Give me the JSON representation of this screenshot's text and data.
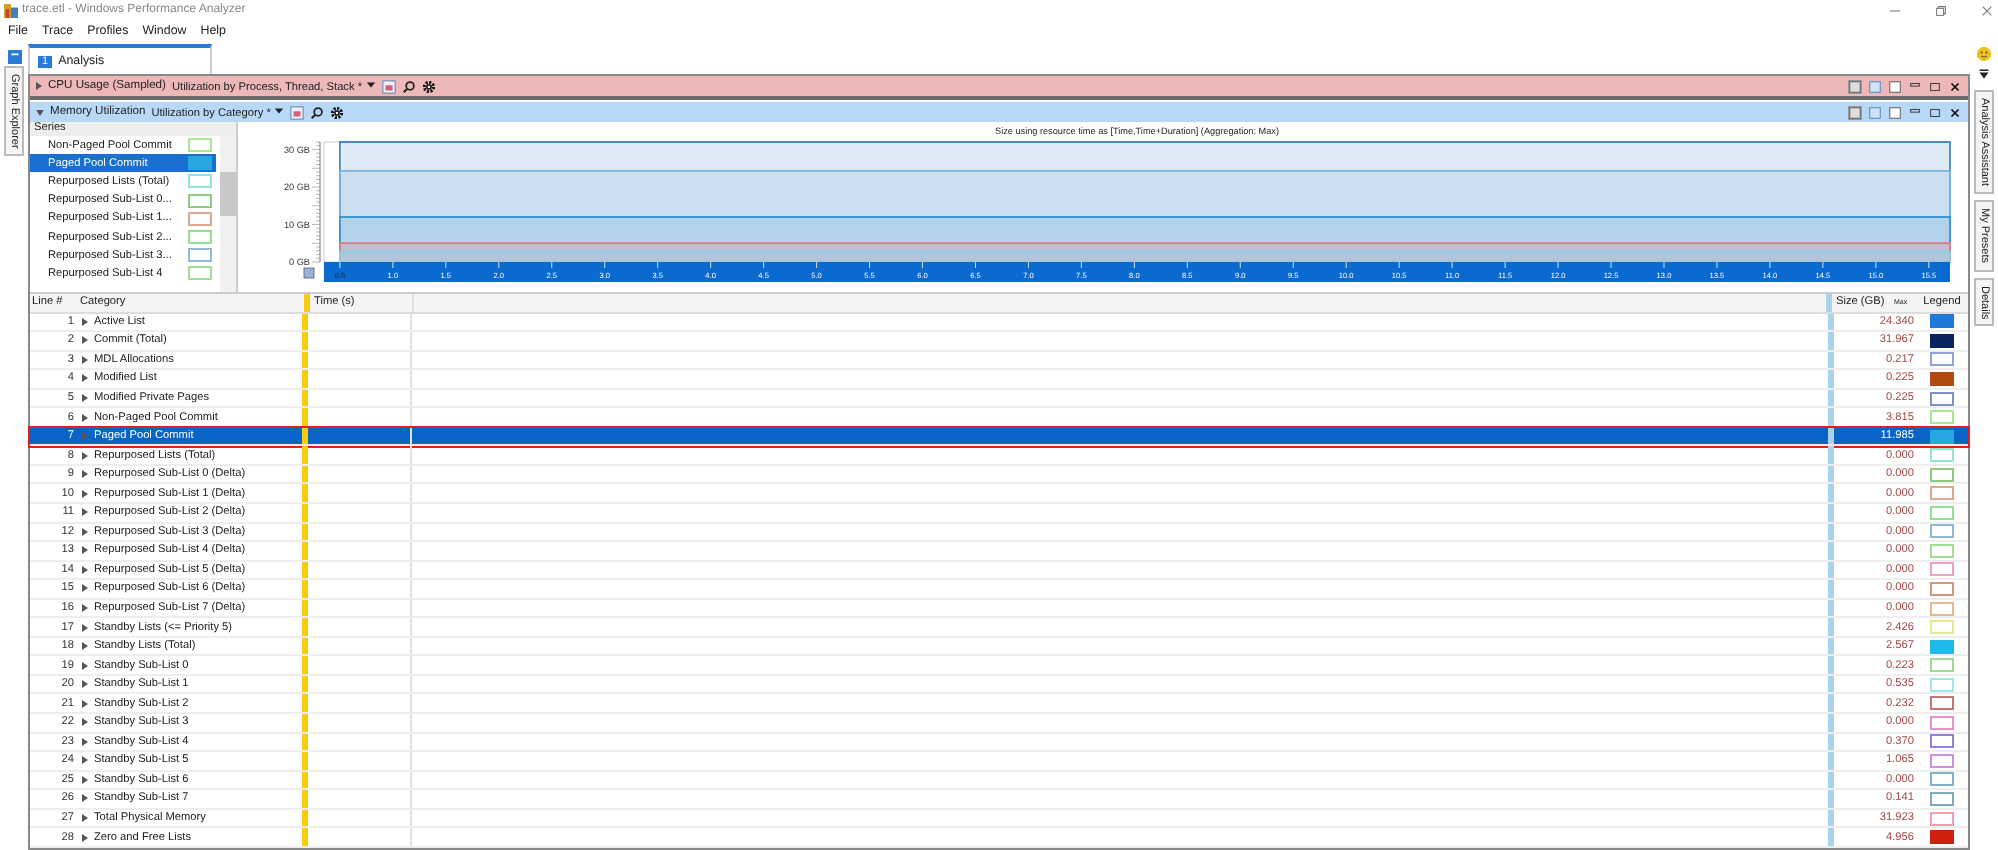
{
  "window": {
    "title": "trace.etl - Windows Performance Analyzer"
  },
  "menu": [
    "File",
    "Trace",
    "Profiles",
    "Window",
    "Help"
  ],
  "left_tabs": [
    {
      "label": "Graph Explorer"
    }
  ],
  "right_tabs": [
    {
      "label": "Analysis Assistant"
    },
    {
      "label": "My Presets"
    },
    {
      "label": "Details"
    }
  ],
  "analysis_tab": {
    "number": "1",
    "label": "Analysis"
  },
  "graphs": [
    {
      "title": "CPU Usage (Sampled)",
      "preset": "Utilization by Process, Thread, Stack *",
      "expanded": false
    },
    {
      "title": "Memory Utilization",
      "preset": "Utilization by Category *",
      "expanded": true
    }
  ],
  "series_panel": {
    "heading": "Series",
    "items": [
      {
        "label": "Non-Paged Pool Commit",
        "color": "#a8e890",
        "filled": false,
        "selected": false
      },
      {
        "label": "Paged Pool Commit",
        "color": "#28a8e0",
        "filled": true,
        "selected": true
      },
      {
        "label": "Repurposed Lists (Total)",
        "color": "#90e8d0",
        "filled": false,
        "selected": false
      },
      {
        "label": "Repurposed Sub-List 0...",
        "color": "#90c880",
        "filled": false,
        "selected": false
      },
      {
        "label": "Repurposed Sub-List 1...",
        "color": "#e0a890",
        "filled": false,
        "selected": false
      },
      {
        "label": "Repurposed Sub-List 2...",
        "color": "#90e090",
        "filled": false,
        "selected": false
      },
      {
        "label": "Repurposed Sub-List 3...",
        "color": "#90b8d8",
        "filled": false,
        "selected": false
      },
      {
        "label": "Repurposed Sub-List 4",
        "color": "#a0e090",
        "filled": false,
        "selected": false
      }
    ]
  },
  "chart": {
    "title": "Size using resource time as [Time,Time+Duration] (Aggregation: Max)",
    "y_labels": [
      "30 GB",
      "20 GB",
      "10 GB",
      "0 GB"
    ],
    "x_labels": [
      "0.5",
      "1.0",
      "1.5",
      "2.0",
      "2.5",
      "3.0",
      "3.5",
      "4.0",
      "4.5",
      "5.0",
      "5.5",
      "6.0",
      "6.5",
      "7.0",
      "7.5",
      "8.0",
      "8.5",
      "9.0",
      "9.5",
      "10.0",
      "10.5",
      "11.0",
      "11.5",
      "12.0",
      "12.5",
      "13.0",
      "13.5",
      "14.0",
      "14.5",
      "15.0",
      "15.5"
    ]
  },
  "table": {
    "columns": [
      "Line #",
      "Category",
      "Time (s)",
      "Size (GB)",
      "Legend"
    ],
    "size_aggregation": "Max",
    "rows": [
      {
        "line": "1",
        "category": "Active List",
        "size": "24.340",
        "color": "#1e78d8",
        "filled": true,
        "selected": false
      },
      {
        "line": "2",
        "category": "Commit (Total)",
        "size": "31.967",
        "color": "#0a2460",
        "filled": true,
        "selected": false
      },
      {
        "line": "3",
        "category": "MDL Allocations",
        "size": "0.217",
        "color": "#8fa4d8",
        "filled": false,
        "selected": false
      },
      {
        "line": "4",
        "category": "Modified List",
        "size": "0.225",
        "color": "#b04a10",
        "filled": true,
        "selected": false
      },
      {
        "line": "5",
        "category": "Modified Private Pages",
        "size": "0.225",
        "color": "#8090c0",
        "filled": false,
        "selected": false
      },
      {
        "line": "6",
        "category": "Non-Paged Pool Commit",
        "size": "3.815",
        "color": "#a8e890",
        "filled": false,
        "selected": false
      },
      {
        "line": "7",
        "category": "Paged Pool Commit",
        "size": "11.985",
        "color": "#28a8e0",
        "filled": true,
        "selected": true
      },
      {
        "line": "8",
        "category": "Repurposed Lists (Total)",
        "size": "0.000",
        "color": "#90e8d0",
        "filled": false,
        "selected": false
      },
      {
        "line": "9",
        "category": "Repurposed Sub-List 0 (Delta)",
        "size": "0.000",
        "color": "#90c880",
        "filled": false,
        "selected": false
      },
      {
        "line": "10",
        "category": "Repurposed Sub-List 1 (Delta)",
        "size": "0.000",
        "color": "#e0a890",
        "filled": false,
        "selected": false
      },
      {
        "line": "11",
        "category": "Repurposed Sub-List 2 (Delta)",
        "size": "0.000",
        "color": "#90e090",
        "filled": false,
        "selected": false
      },
      {
        "line": "12",
        "category": "Repurposed Sub-List 3 (Delta)",
        "size": "0.000",
        "color": "#90b8d8",
        "filled": false,
        "selected": false
      },
      {
        "line": "13",
        "category": "Repurposed Sub-List 4 (Delta)",
        "size": "0.000",
        "color": "#a0e090",
        "filled": false,
        "selected": false
      },
      {
        "line": "14",
        "category": "Repurposed Sub-List 5 (Delta)",
        "size": "0.000",
        "color": "#f0a0c0",
        "filled": false,
        "selected": false
      },
      {
        "line": "15",
        "category": "Repurposed Sub-List 6 (Delta)",
        "size": "0.000",
        "color": "#d09880",
        "filled": false,
        "selected": false
      },
      {
        "line": "16",
        "category": "Repurposed Sub-List 7 (Delta)",
        "size": "0.000",
        "color": "#e8b890",
        "filled": false,
        "selected": false
      },
      {
        "line": "17",
        "category": "Standby Lists (<= Priority 5)",
        "size": "2.426",
        "color": "#e8e890",
        "filled": false,
        "selected": false
      },
      {
        "line": "18",
        "category": "Standby Lists (Total)",
        "size": "2.567",
        "color": "#20b8e8",
        "filled": true,
        "selected": false
      },
      {
        "line": "19",
        "category": "Standby Sub-List 0",
        "size": "0.223",
        "color": "#a0d890",
        "filled": false,
        "selected": false
      },
      {
        "line": "20",
        "category": "Standby Sub-List 1",
        "size": "0.535",
        "color": "#a0e8e8",
        "filled": false,
        "selected": false
      },
      {
        "line": "21",
        "category": "Standby Sub-List 2",
        "size": "0.232",
        "color": "#c07878",
        "filled": false,
        "selected": false
      },
      {
        "line": "22",
        "category": "Standby Sub-List 3",
        "size": "0.000",
        "color": "#e890c8",
        "filled": false,
        "selected": false
      },
      {
        "line": "23",
        "category": "Standby Sub-List 4",
        "size": "0.370",
        "color": "#9080e0",
        "filled": false,
        "selected": false
      },
      {
        "line": "24",
        "category": "Standby Sub-List 5",
        "size": "1.065",
        "color": "#d090e0",
        "filled": false,
        "selected": false
      },
      {
        "line": "25",
        "category": "Standby Sub-List 6",
        "size": "0.000",
        "color": "#80b0c8",
        "filled": false,
        "selected": false
      },
      {
        "line": "26",
        "category": "Standby Sub-List 7",
        "size": "0.141",
        "color": "#80a8c0",
        "filled": false,
        "selected": false
      },
      {
        "line": "27",
        "category": "Total Physical Memory",
        "size": "31.923",
        "color": "#f0a0b0",
        "filled": false,
        "selected": false
      },
      {
        "line": "28",
        "category": "Zero and Free Lists",
        "size": "4.956",
        "color": "#d02010",
        "filled": true,
        "selected": false
      }
    ]
  }
}
